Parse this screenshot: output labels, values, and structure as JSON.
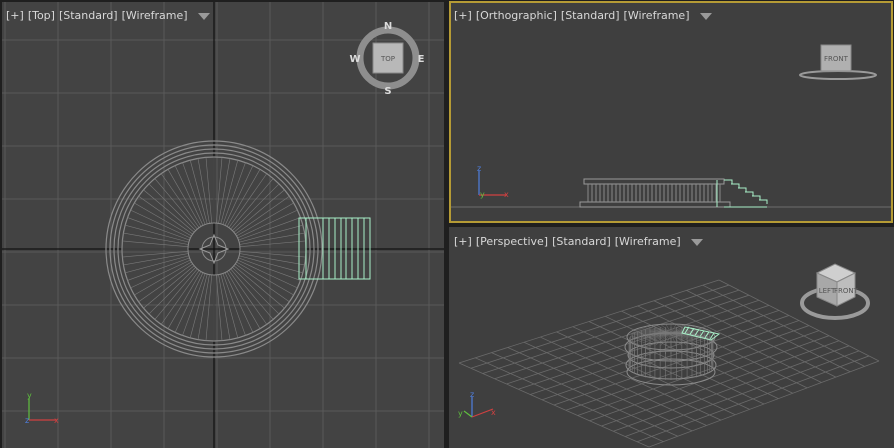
{
  "viewports": {
    "top": {
      "plus": "[+]",
      "view": "[Top]",
      "shading": "[Standard]",
      "mode": "[Wireframe]"
    },
    "ortho": {
      "plus": "[+]",
      "view": "[Orthographic]",
      "shading": "[Standard]",
      "mode": "[Wireframe]"
    },
    "persp": {
      "plus": "[+]",
      "view": "[Perspective]",
      "shading": "[Standard]",
      "mode": "[Wireframe]"
    }
  },
  "viewcube": {
    "top_face": "TOP",
    "front_face": "FRONT",
    "persp_left_face": "LEFT",
    "persp_front_face": "FRONT",
    "compass": {
      "n": "N",
      "s": "S",
      "e": "E",
      "w": "W"
    }
  },
  "axes": {
    "x": "x",
    "y": "y",
    "z": "z"
  },
  "colors": {
    "active_border": "#b59b35",
    "selection": "#a8f0c8",
    "wire": "#8a8a8a",
    "grid": "#5a5a5a"
  }
}
